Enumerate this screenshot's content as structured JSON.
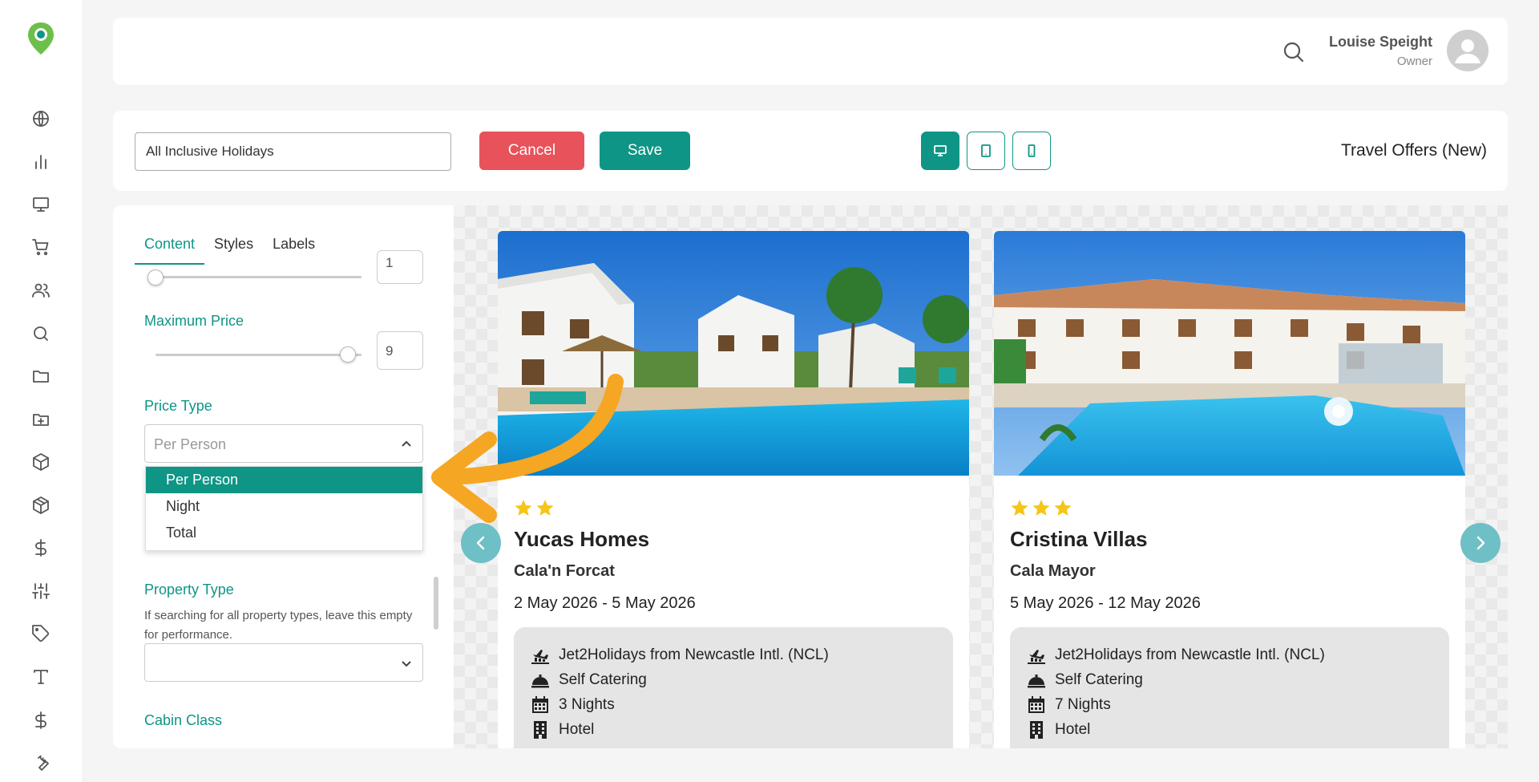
{
  "header": {
    "user_name": "Louise Speight",
    "user_role": "Owner"
  },
  "toolbar": {
    "name_value": "All Inclusive Holidays",
    "cancel_label": "Cancel",
    "save_label": "Save",
    "page_title": "Travel Offers (New)"
  },
  "panel": {
    "tabs": [
      {
        "label": "Content",
        "active": true
      },
      {
        "label": "Styles",
        "active": false
      },
      {
        "label": "Labels",
        "active": false
      }
    ],
    "min_price": {
      "value": "1"
    },
    "max_price": {
      "label": "Maximum Price",
      "value": "9"
    },
    "price_type": {
      "label": "Price Type",
      "selected": "Per Person",
      "options": [
        "Per Person",
        "Night",
        "Total"
      ]
    },
    "property_type": {
      "label": "Property Type",
      "help": "If searching for all property types, leave this empty for performance.",
      "value": ""
    },
    "cabin_class": {
      "label": "Cabin Class"
    }
  },
  "preview": {
    "cards": [
      {
        "title": "Yucas Homes",
        "location": "Cala'n Forcat",
        "dates": "2 May 2026 - 5 May 2026",
        "star_rating": 2,
        "details": [
          "Jet2Holidays from Newcastle Intl. (NCL)",
          "Self Catering",
          "3 Nights",
          "Hotel"
        ]
      },
      {
        "title": "Cristina Villas",
        "location": "Cala Mayor",
        "dates": "5 May 2026 - 12 May 2026",
        "star_rating": 3,
        "details": [
          "Jet2Holidays from Newcastle Intl. (NCL)",
          "Self Catering",
          "7 Nights",
          "Hotel"
        ]
      }
    ]
  },
  "colors": {
    "accent": "#0f9585",
    "cancel": "#e8525a",
    "star": "#f5c518",
    "annotation": "#f5a623",
    "nav_arrow": "#6fbfc6"
  },
  "icons": {
    "sidebar": [
      "globe-icon",
      "chart-icon",
      "monitor-icon",
      "cart-icon",
      "users-icon",
      "search-icon",
      "folder-icon",
      "folder-plus-icon",
      "box-icon",
      "package-icon",
      "dollar-icon",
      "sliders-icon",
      "tag-icon",
      "type-icon",
      "dollar-icon",
      "wrench-icon"
    ],
    "details": [
      "flight-icon",
      "meal-icon",
      "calendar-icon",
      "building-icon"
    ]
  }
}
